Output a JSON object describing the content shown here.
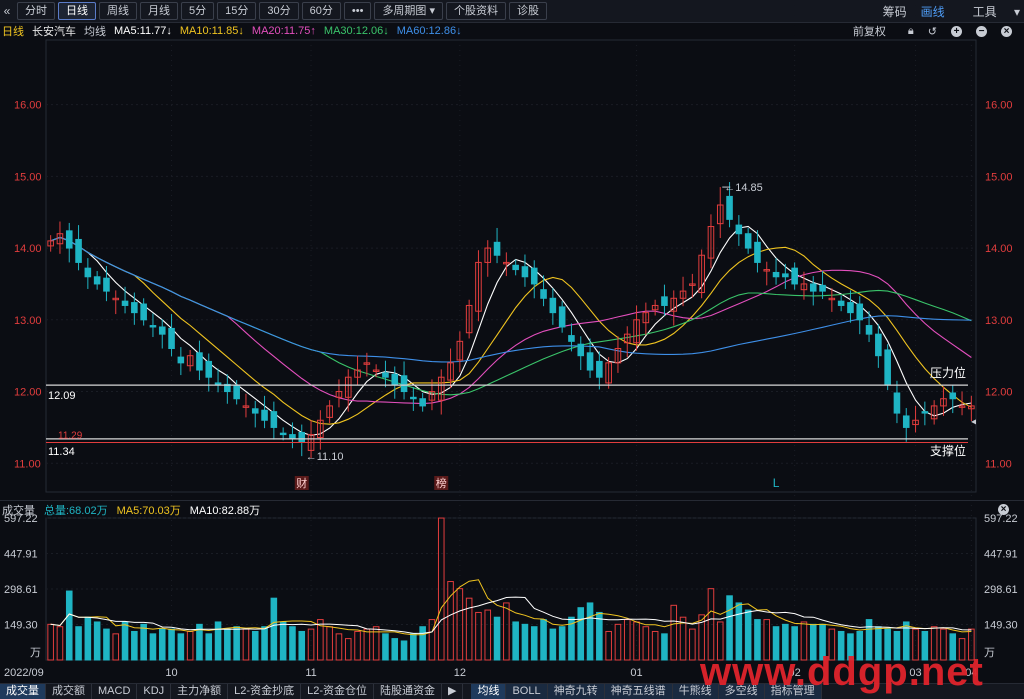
{
  "toolbar": {
    "back_icon": "«",
    "periods": [
      "分时",
      "日线",
      "周线",
      "月线",
      "5分",
      "15分",
      "30分",
      "60分"
    ],
    "active_period": "日线",
    "more_label": "•••",
    "multi_period_label": "多周期图",
    "stock_info_label": "个股资料",
    "diagnose_label": "诊股",
    "right": {
      "chips_label": "筹码",
      "draw_label": "画线",
      "tools_label": "工具"
    }
  },
  "info": {
    "period": "日线",
    "name": "长安汽车",
    "ma_label": "均线",
    "ma5": "MA5:11.77↓",
    "ma10": "MA10:11.85↓",
    "ma20": "MA20:11.75↑",
    "ma30": "MA30:12.06↓",
    "ma60": "MA60:12.86↓",
    "adjust_label": "前复权"
  },
  "price_axis": {
    "ticks": [
      "16.00",
      "15.00",
      "14.00",
      "13.00",
      "12.00",
      "11.00"
    ]
  },
  "annotations": {
    "high_label": "14.85",
    "low_label": "11.10",
    "resistance_price": "12.09",
    "resistance_label": "压力位",
    "support_price": "11.34",
    "support_label": "支撑位",
    "red_line_price": "11.29",
    "marker_cai": "财",
    "marker_bang": "榜",
    "marker_L": "L"
  },
  "volume": {
    "title": "成交量",
    "total": "总量:68.02万",
    "ma5": "MA5:70.03万",
    "ma10": "MA10:82.88万",
    "ticks": [
      "597.22",
      "447.91",
      "298.61",
      "149.30"
    ],
    "unit": "万"
  },
  "x_labels": [
    "2022/09",
    "10",
    "11",
    "12",
    "01",
    "02",
    "03",
    "04"
  ],
  "bottom_tabs": [
    "成交量",
    "成交额",
    "MACD",
    "KDJ",
    "主力净额",
    "L2-资金抄底",
    "L2-资金仓位",
    "陆股通资金"
  ],
  "bottom_tabs_right": [
    "均线",
    "BOLL",
    "神奇九转",
    "神奇五线谱",
    "牛熊线",
    "多空线",
    "指标管理"
  ],
  "watermark": "www.ddgp.net",
  "colors": {
    "up": "#e23d3d",
    "down": "#1fb5c4",
    "ma5": "#ffffff",
    "ma10": "#f0c420",
    "ma20": "#e34fbd",
    "ma30": "#3ac46a",
    "ma60": "#3e8fe8",
    "accent": "#4e9cf5"
  },
  "chart_data": {
    "type": "candlestick",
    "price_ylim": [
      10.6,
      16.9
    ],
    "volume_ylim": [
      0,
      597.22
    ],
    "high": 14.85,
    "low": 11.1,
    "closes": [
      14.1,
      14.2,
      14.0,
      13.8,
      13.6,
      13.5,
      13.4,
      13.3,
      13.2,
      13.1,
      13.0,
      12.9,
      12.8,
      12.6,
      12.4,
      12.5,
      12.3,
      12.2,
      12.1,
      12.0,
      11.9,
      11.8,
      11.7,
      11.6,
      11.5,
      11.4,
      11.35,
      11.3,
      11.4,
      11.6,
      11.8,
      12.0,
      12.2,
      12.3,
      12.4,
      12.3,
      12.2,
      12.1,
      12.0,
      11.9,
      11.8,
      12.0,
      12.2,
      12.4,
      12.7,
      13.2,
      13.8,
      14.0,
      13.9,
      13.8,
      13.7,
      13.6,
      13.5,
      13.3,
      13.1,
      12.9,
      12.7,
      12.5,
      12.3,
      12.2,
      12.4,
      12.6,
      12.8,
      13.0,
      13.1,
      13.2,
      13.2,
      13.3,
      13.4,
      13.5,
      13.9,
      14.3,
      14.6,
      14.4,
      14.2,
      14.0,
      13.8,
      13.7,
      13.6,
      13.6,
      13.5,
      13.5,
      13.4,
      13.4,
      13.3,
      13.2,
      13.1,
      13.0,
      12.8,
      12.5,
      12.1,
      11.7,
      11.5,
      11.6,
      11.7,
      11.8,
      11.9,
      11.9,
      11.8,
      11.8
    ],
    "volumes": [
      150,
      140,
      290,
      140,
      180,
      160,
      130,
      110,
      160,
      120,
      150,
      110,
      130,
      130,
      110,
      120,
      150,
      110,
      160,
      130,
      140,
      130,
      120,
      140,
      260,
      160,
      140,
      120,
      130,
      170,
      140,
      110,
      90,
      120,
      130,
      140,
      110,
      90,
      80,
      110,
      140,
      170,
      597,
      330,
      300,
      260,
      200,
      210,
      180,
      240,
      160,
      150,
      140,
      170,
      130,
      140,
      180,
      220,
      240,
      200,
      120,
      150,
      170,
      160,
      140,
      120,
      110,
      230,
      180,
      130,
      190,
      300,
      160,
      270,
      240,
      210,
      170,
      170,
      140,
      150,
      140,
      160,
      150,
      150,
      130,
      120,
      110,
      120,
      170,
      140,
      130,
      120,
      160,
      130,
      120,
      140,
      130,
      110,
      90,
      130
    ],
    "ma_last": {
      "MA5": 11.77,
      "MA10": 11.85,
      "MA20": 11.75,
      "MA30": 12.06,
      "MA60": 12.86
    },
    "resistance": 12.09,
    "support": 11.34
  }
}
